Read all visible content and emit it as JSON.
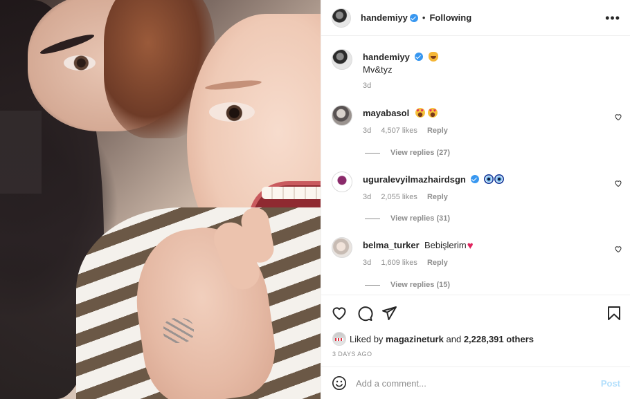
{
  "post": {
    "username": "handemiyy",
    "following_label": "Following",
    "more_label": "•••"
  },
  "caption": {
    "username": "handemiyy",
    "text": "Mv&tyz",
    "time": "3d"
  },
  "comments": [
    {
      "username": "mayabasol",
      "text": "",
      "time": "3d",
      "likes": "4,507 likes",
      "reply": "Reply",
      "view_replies": "View replies (27)"
    },
    {
      "username": "uguralevyilmazhairdsgn",
      "text": "",
      "time": "3d",
      "likes": "2,055 likes",
      "reply": "Reply",
      "view_replies": "View replies (31)"
    },
    {
      "username": "belma_turker",
      "text": "Bebişlerim",
      "time": "3d",
      "likes": "1,609 likes",
      "reply": "Reply",
      "view_replies": "View replies (15)"
    }
  ],
  "likes": {
    "prefix": "Liked by",
    "user": "magazineturk",
    "conjunction": "and",
    "others": "2,228,391 others"
  },
  "time_ago": "3 DAYS AGO",
  "comment_box": {
    "placeholder": "Add a comment...",
    "post_label": "Post"
  },
  "colors": {
    "verified": "#3897f0",
    "post_disabled": "#b2dffc",
    "meta_gray": "#8e8e8e"
  }
}
